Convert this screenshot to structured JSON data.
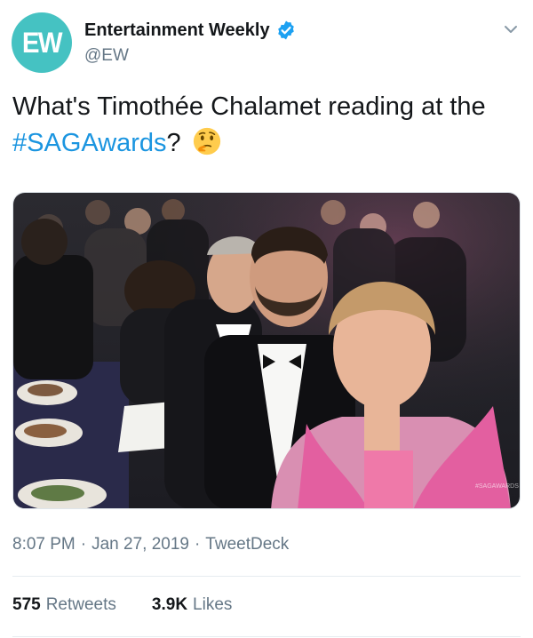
{
  "account": {
    "avatar_text": "EW",
    "display_name": "Entertainment Weekly",
    "handle": "@EW",
    "verified_icon": "verified-badge-icon",
    "menu_icon": "chevron-down-icon"
  },
  "tweet": {
    "text_prefix": "What's Timothée Chalamet reading at the ",
    "hashtag": "#SAGAwards",
    "text_suffix": "?",
    "emoji": "thinking-face-emoji",
    "media_watermark": "#SAGAWARDS"
  },
  "meta": {
    "time": "8:07 PM",
    "date": "Jan 27, 2019",
    "source": "TweetDeck",
    "separator": "·"
  },
  "stats": {
    "retweets_count": "575",
    "retweets_label": "Retweets",
    "likes_count": "3.9K",
    "likes_label": "Likes"
  },
  "colors": {
    "avatar": "#45c2c2",
    "link": "#1b95e0",
    "muted": "#657786",
    "verified": "#1da1f2"
  }
}
